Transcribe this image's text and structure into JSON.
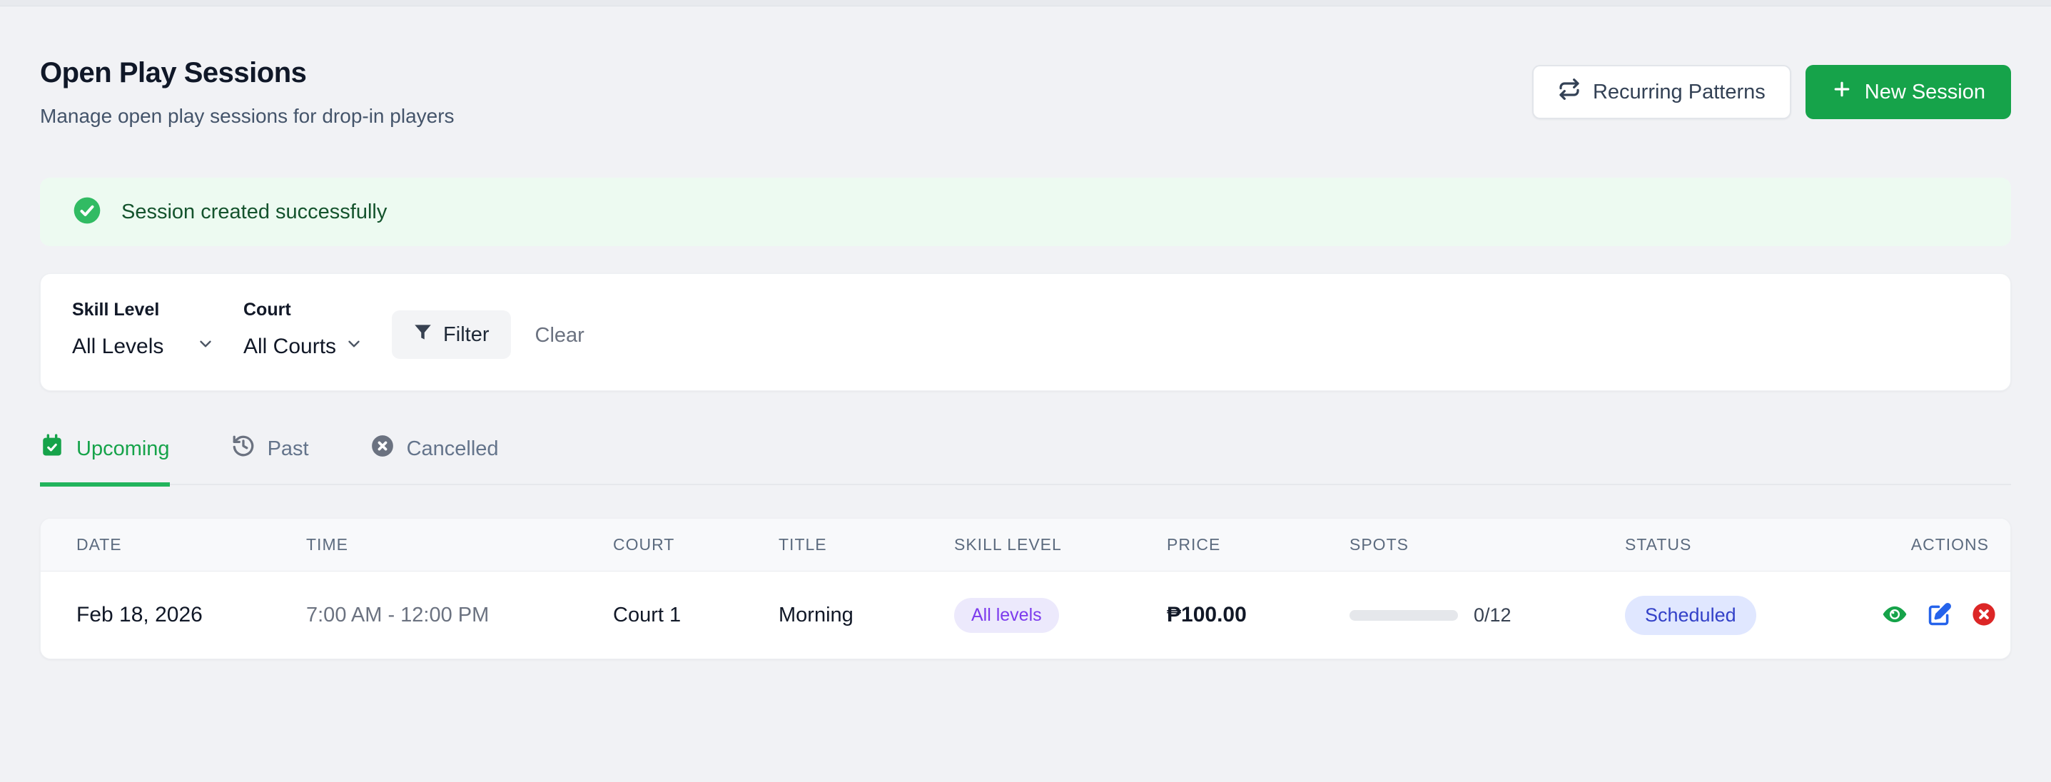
{
  "page": {
    "title": "Open Play Sessions",
    "subtitle": "Manage open play sessions for drop-in players"
  },
  "header_actions": {
    "recurring_patterns_label": "Recurring Patterns",
    "new_session_label": "New Session"
  },
  "alert": {
    "message": "Session created successfully"
  },
  "filters": {
    "skill_level": {
      "label": "Skill Level",
      "value": "All Levels"
    },
    "court": {
      "label": "Court",
      "value": "All Courts"
    },
    "filter_button_label": "Filter",
    "clear_label": "Clear"
  },
  "tabs": [
    {
      "label": "Upcoming",
      "active": true
    },
    {
      "label": "Past",
      "active": false
    },
    {
      "label": "Cancelled",
      "active": false
    }
  ],
  "table": {
    "columns": [
      "DATE",
      "TIME",
      "COURT",
      "TITLE",
      "SKILL LEVEL",
      "PRICE",
      "SPOTS",
      "STATUS",
      "ACTIONS"
    ],
    "rows": [
      {
        "date": "Feb 18, 2026",
        "time": "7:00 AM - 12:00 PM",
        "court": "Court 1",
        "title": "Morning",
        "skill_level": "All levels",
        "price": "₱100.00",
        "spots": "0/12",
        "spots_filled": 0,
        "spots_total": 12,
        "status": "Scheduled"
      }
    ]
  },
  "colors": {
    "accent_green": "#16a34a",
    "banner_bg": "#edfaf1",
    "banner_text": "#14532d",
    "skill_badge_bg": "#ece9fc",
    "skill_badge_text": "#7c3aed",
    "status_badge_bg": "#e0e7ff",
    "status_badge_text": "#3341c8",
    "view_icon_green": "#16a34a",
    "edit_icon_blue": "#2563eb",
    "cancel_icon_red": "#dc2626"
  }
}
